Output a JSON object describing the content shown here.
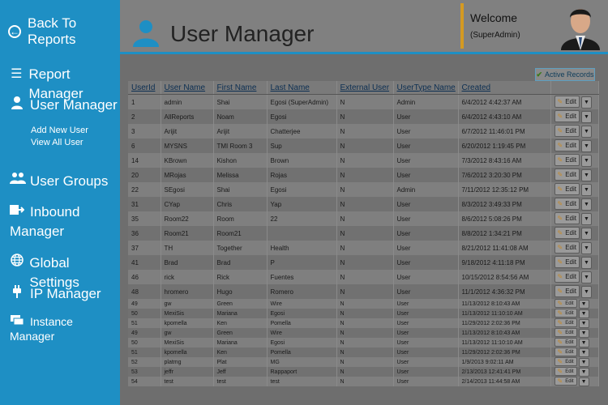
{
  "sidebar": {
    "back": "Back To Reports",
    "report_manager": "Report Manager",
    "user_manager": "User Manager",
    "add_new_user": "Add New User",
    "view_all_user": "View All User",
    "user_groups": "User Groups",
    "inbound_line1": "Inbound",
    "inbound_line2": "Manager",
    "global_settings": "Global Settings",
    "ip_manager": "IP Manager",
    "instance_line1": "Instance",
    "instance_line2": "Manager"
  },
  "header": {
    "title": "User Manager",
    "welcome": "Welcome",
    "welcome_user": "(SuperAdmin)"
  },
  "active_records_label": "Active Records",
  "edit_label": "Edit",
  "dropdown_arrow": "▼",
  "colors": {
    "accent": "#1e8fc4",
    "welcome_bar": "#d49a22"
  },
  "table": {
    "headers": {
      "userid": "UserId",
      "username": "User Name",
      "firstname": "First Name",
      "lastname": "Last Name",
      "external": "External User",
      "usertype": "UserType Name",
      "created": "Created"
    },
    "rows": [
      {
        "size": "big",
        "c": [
          "1",
          "admin",
          "Shai",
          "Egosi (SuperAdmin)",
          "N",
          "Admin",
          "6/4/2012 4:42:37 AM"
        ]
      },
      {
        "size": "big",
        "c": [
          "2",
          "AllReports",
          "Noam",
          "Egosi",
          "N",
          "User",
          "6/4/2012 4:43:10 AM"
        ]
      },
      {
        "size": "big",
        "c": [
          "3",
          "Arijit",
          "Arijit",
          "Chatterjee",
          "N",
          "User",
          "6/7/2012 11:46:01 PM"
        ]
      },
      {
        "size": "big",
        "c": [
          "6",
          "MYSNS",
          "TMI Room 3",
          "Sup",
          "N",
          "User",
          "6/20/2012 1:19:45 PM"
        ]
      },
      {
        "size": "big",
        "c": [
          "14",
          "KBrown",
          "Kishon",
          "Brown",
          "N",
          "User",
          "7/3/2012 8:43:16 AM"
        ]
      },
      {
        "size": "big",
        "c": [
          "20",
          "MRojas",
          "Melissa",
          "Rojas",
          "N",
          "User",
          "7/6/2012 3:20:30 PM"
        ]
      },
      {
        "size": "big",
        "c": [
          "22",
          "SEgosi",
          "Shai",
          "Egosi",
          "N",
          "Admin",
          "7/11/2012 12:35:12 PM"
        ]
      },
      {
        "size": "big",
        "c": [
          "31",
          "CYap",
          "Chris",
          "Yap",
          "N",
          "User",
          "8/3/2012 3:49:33 PM"
        ]
      },
      {
        "size": "big",
        "c": [
          "35",
          "Room22",
          "Room",
          "22",
          "N",
          "User",
          "8/6/2012 5:08:26 PM"
        ]
      },
      {
        "size": "big",
        "c": [
          "36",
          "Room21",
          "Room21",
          "",
          "N",
          "User",
          "8/8/2012 1:34:21 PM"
        ]
      },
      {
        "size": "big",
        "c": [
          "37",
          "TH",
          "Together",
          "Health",
          "N",
          "User",
          "8/21/2012 11:41:08 AM"
        ]
      },
      {
        "size": "big",
        "c": [
          "41",
          "Brad",
          "Brad",
          "P",
          "N",
          "User",
          "9/18/2012 4:11:18 PM"
        ]
      },
      {
        "size": "big",
        "c": [
          "46",
          "rick",
          "Rick",
          "Fuentes",
          "N",
          "User",
          "10/15/2012 8:54:56 AM"
        ]
      },
      {
        "size": "big",
        "c": [
          "48",
          "hromero",
          "Hugo",
          "Romero",
          "N",
          "User",
          "11/1/2012 4:36:32 PM"
        ]
      },
      {
        "size": "small",
        "c": [
          "49",
          "gw",
          "Green",
          "Wire",
          "N",
          "User",
          "11/13/2012 8:10:43 AM"
        ]
      },
      {
        "size": "small",
        "c": [
          "50",
          "MexiSis",
          "Mariana",
          "Egosi",
          "N",
          "User",
          "11/13/2012 11:10:10 AM"
        ]
      },
      {
        "size": "small",
        "c": [
          "51",
          "kpomella",
          "Ken",
          "Pomella",
          "N",
          "User",
          "11/29/2012 2:02:36 PM"
        ]
      },
      {
        "size": "small",
        "c": [
          "49",
          "gw",
          "Green",
          "Wire",
          "N",
          "User",
          "11/13/2012 8:10:43 AM"
        ]
      },
      {
        "size": "small",
        "c": [
          "50",
          "MexiSis",
          "Mariana",
          "Egosi",
          "N",
          "User",
          "11/13/2012 11:10:10 AM"
        ]
      },
      {
        "size": "small",
        "c": [
          "51",
          "kpomella",
          "Ken",
          "Pomella",
          "N",
          "User",
          "11/29/2012 2:02:36 PM"
        ]
      },
      {
        "size": "small",
        "c": [
          "52",
          "platmg",
          "Plat",
          "MG",
          "N",
          "User",
          "1/9/2013 9:02:11 AM"
        ]
      },
      {
        "size": "small",
        "c": [
          "53",
          "jeffr",
          "Jeff",
          "Rappaport",
          "N",
          "User",
          "2/13/2013 12:41:41 PM"
        ]
      },
      {
        "size": "small",
        "c": [
          "54",
          "test",
          "test",
          "test",
          "N",
          "User",
          "2/14/2013 11:44:58 AM"
        ]
      }
    ]
  }
}
